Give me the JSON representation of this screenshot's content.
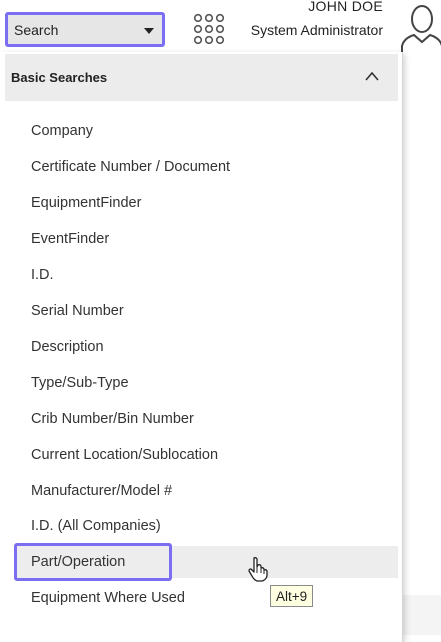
{
  "header": {
    "search_select_value": "Search",
    "user_name": "JOHN DOE",
    "user_role": "System Administrator"
  },
  "menu": {
    "section_title": "Basic Searches",
    "items": [
      "Company",
      "Certificate Number / Document",
      "EquipmentFinder",
      "EventFinder",
      "I.D.",
      "Serial Number",
      "Description",
      "Type/Sub-Type",
      "Crib Number/Bin Number",
      "Current Location/Sublocation",
      "Manufacturer/Model #",
      "I.D. (All Companies)",
      "Part/Operation",
      "Equipment Where Used"
    ],
    "hovered_item": "Part/Operation"
  },
  "tooltip": {
    "text": "Alt+9"
  },
  "colors": {
    "highlight_border": "#7c6ef0",
    "menu_header_bg": "#ececec",
    "tooltip_bg": "#ffffe1"
  },
  "icons": [
    "caret-down-icon",
    "apps-grid-icon",
    "user-avatar-icon",
    "chevron-up-icon",
    "hand-pointer-icon"
  ]
}
